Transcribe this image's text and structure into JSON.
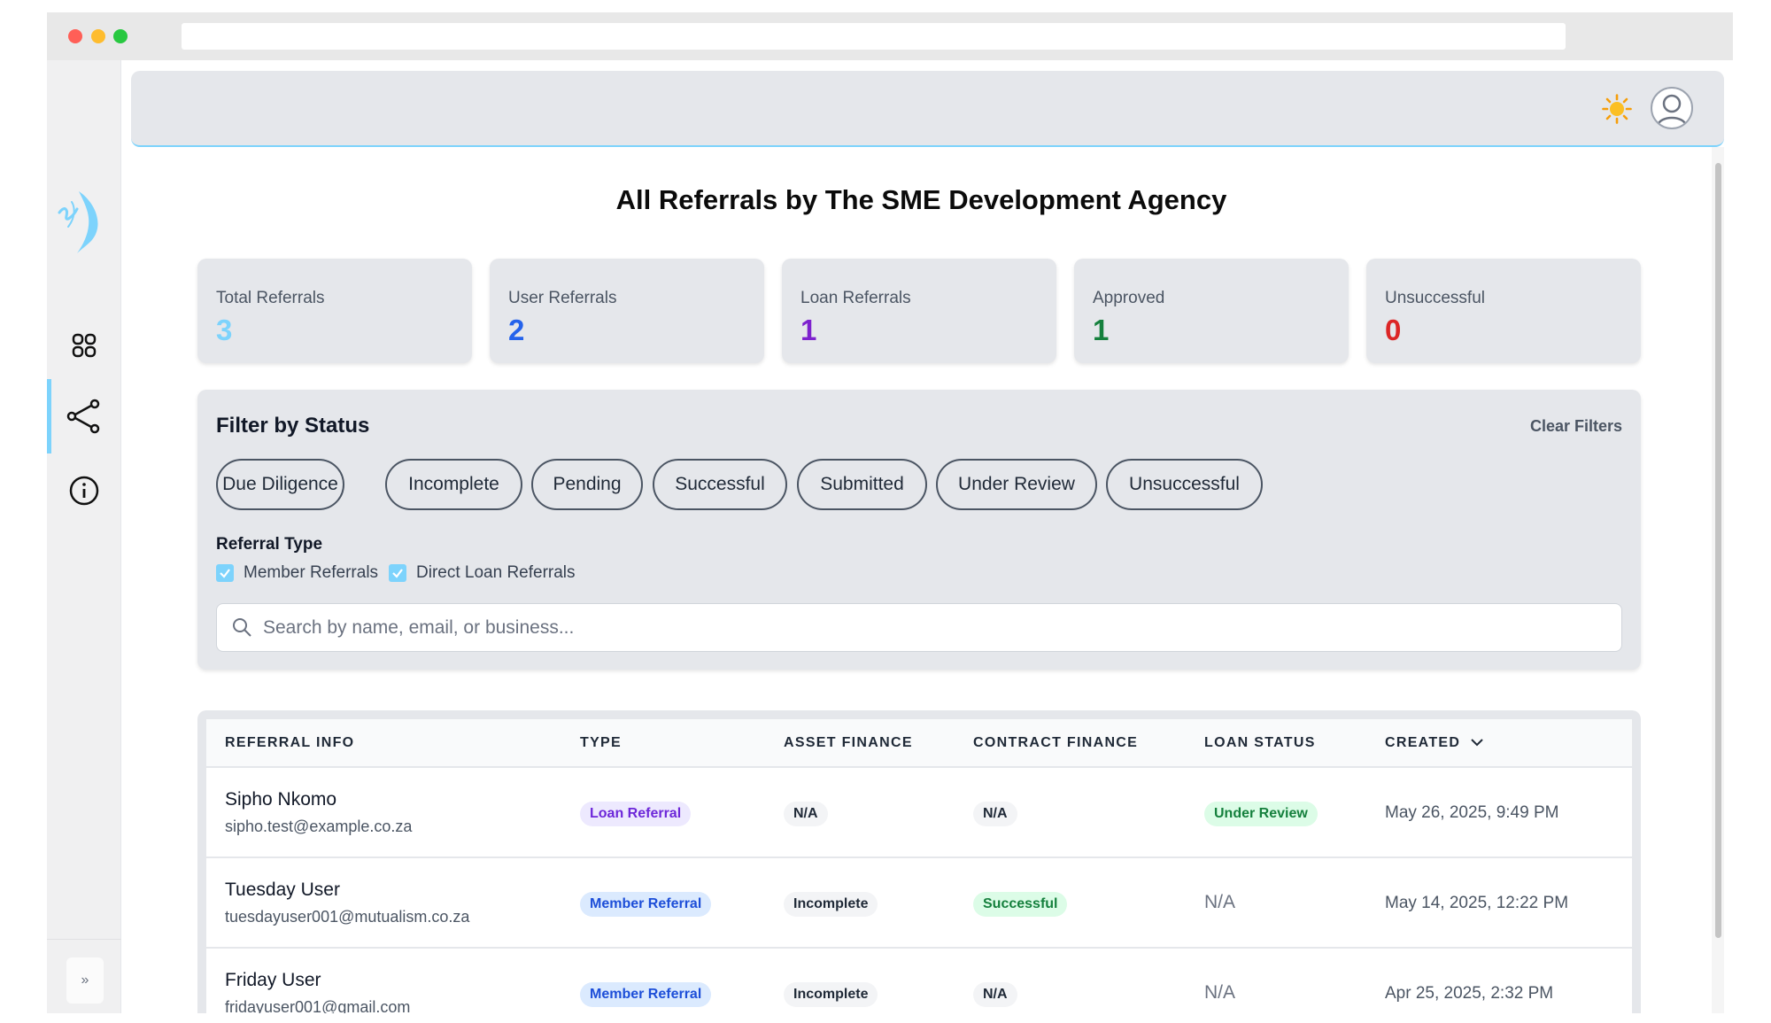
{
  "header": {
    "theme_toggle_icon": "sun-icon",
    "avatar_icon": "user-avatar-icon"
  },
  "sidebar": {
    "items": [
      {
        "icon": "grid-icon",
        "active": false
      },
      {
        "icon": "share-icon",
        "active": true
      },
      {
        "icon": "info-icon",
        "active": false
      }
    ],
    "expand_label": "»"
  },
  "page": {
    "title": "All Referrals by The SME Development Agency"
  },
  "stats": [
    {
      "label": "Total Referrals",
      "value": "3",
      "color": "#7dd3fc"
    },
    {
      "label": "User Referrals",
      "value": "2",
      "color": "#2563eb"
    },
    {
      "label": "Loan Referrals",
      "value": "1",
      "color": "#7e22ce"
    },
    {
      "label": "Approved",
      "value": "1",
      "color": "#15803d"
    },
    {
      "label": "Unsuccessful",
      "value": "0",
      "color": "#dc2626"
    }
  ],
  "filters": {
    "title": "Filter by Status",
    "clear_label": "Clear Filters",
    "statuses": [
      "Due Diligence",
      "Incomplete",
      "Pending",
      "Successful",
      "Submitted",
      "Under Review",
      "Unsuccessful"
    ],
    "type_label": "Referral Type",
    "types": [
      {
        "label": "Member Referrals",
        "checked": true
      },
      {
        "label": "Direct Loan Referrals",
        "checked": true
      }
    ],
    "search_placeholder": "Search by name, email, or business..."
  },
  "table": {
    "headers": [
      "REFERRAL INFO",
      "TYPE",
      "ASSET FINANCE",
      "CONTRACT FINANCE",
      "LOAN STATUS",
      "CREATED"
    ],
    "sort_icon": "chevron-down-icon",
    "rows": [
      {
        "name": "Sipho Nkomo",
        "email": "sipho.test@example.co.za",
        "type": "Loan Referral",
        "asset_finance": "N/A",
        "contract_finance": "N/A",
        "loan_status": "Under Review",
        "created": "May 26, 2025, 9:49 PM"
      },
      {
        "name": "Tuesday User",
        "email": "tuesdayuser001@mutualism.co.za",
        "type": "Member Referral",
        "asset_finance": "Incomplete",
        "contract_finance": "Successful",
        "loan_status": "N/A",
        "created": "May 14, 2025, 12:22 PM"
      },
      {
        "name": "Friday User",
        "email": "fridayuser001@gmail.com",
        "type": "Member Referral",
        "asset_finance": "Incomplete",
        "contract_finance": "N/A",
        "loan_status": "N/A",
        "created": "Apr 25, 2025, 2:32 PM"
      }
    ]
  },
  "colors": {
    "accent": "#7dd3fc",
    "loan_badge_bg": "#ede9fe",
    "loan_badge_fg": "#6d28d9",
    "member_badge_bg": "#dbeafe",
    "member_badge_fg": "#1d4ed8",
    "neutral_badge_bg": "#f3f4f6",
    "neutral_badge_fg": "#1f2937",
    "success_badge_bg": "#dcfce7",
    "success_badge_fg": "#15803d"
  }
}
